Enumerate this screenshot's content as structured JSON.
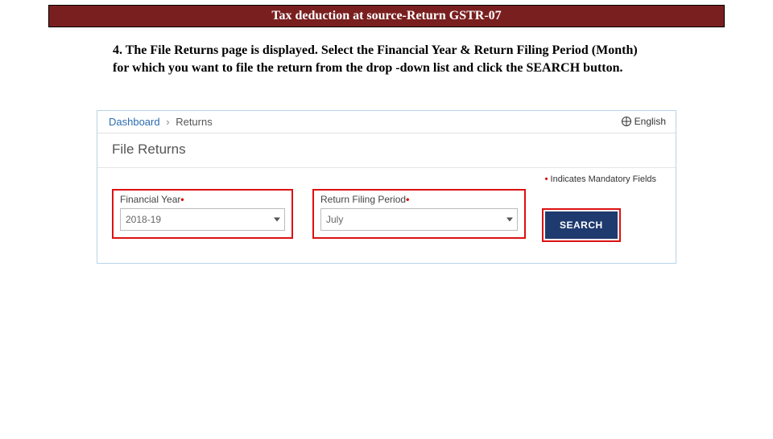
{
  "title_bar": "Tax deduction at source-Return GSTR-07",
  "instruction": "4. The File Returns page is displayed. Select the Financial Year & Return Filing Period (Month) for which you want to file the return from the drop -down list and click the SEARCH button.",
  "breadcrumb": {
    "dashboard": "Dashboard",
    "current": "Returns"
  },
  "language_label": "English",
  "page_title": "File Returns",
  "mandatory_text": "Indicates Mandatory Fields",
  "fields": {
    "financial_year": {
      "label": "Financial Year",
      "value": "2018-19"
    },
    "return_period": {
      "label": "Return Filing Period",
      "value": "July"
    }
  },
  "search_button": "SEARCH"
}
